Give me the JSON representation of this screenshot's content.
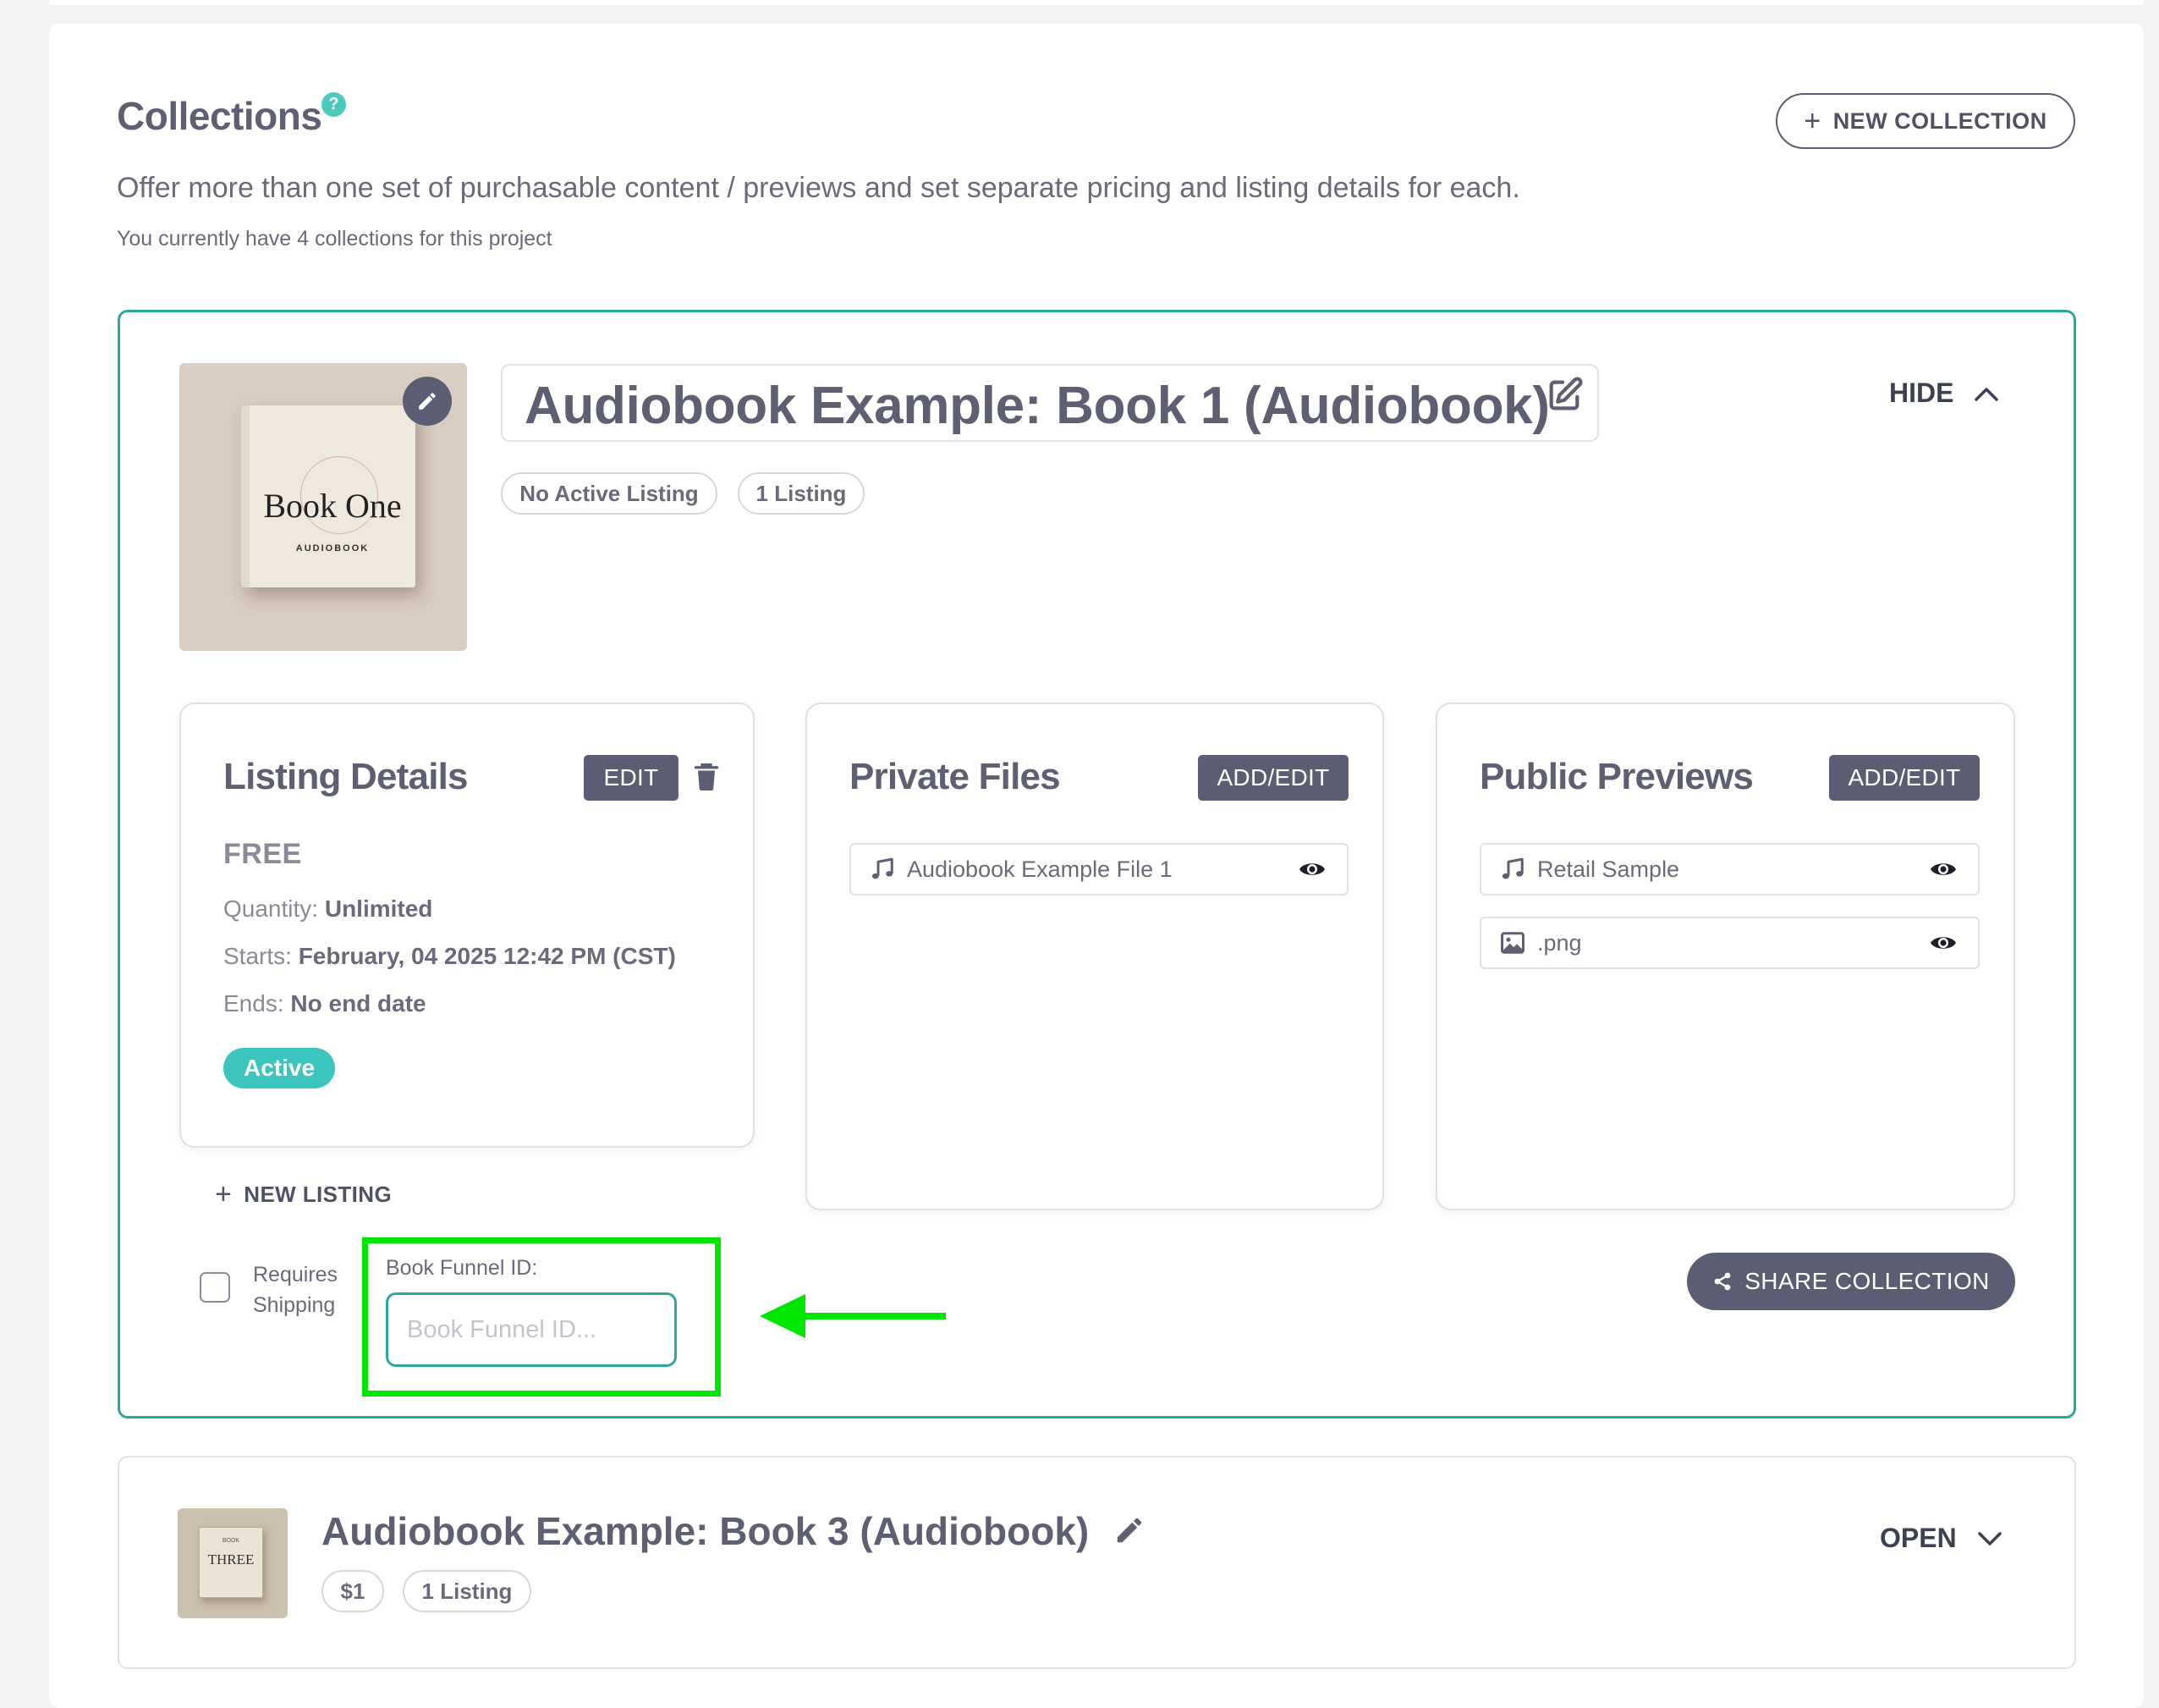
{
  "header": {
    "title": "Collections",
    "help_icon": "?",
    "new_collection_label": "NEW COLLECTION",
    "subtitle": "Offer more than one set of purchasable content / previews and set separate pricing and listing details for each.",
    "count_text": "You currently have 4 collections for this project"
  },
  "collection1": {
    "title": "Audiobook Example: Book 1 (Audiobook)",
    "cover_title": "Book One",
    "cover_subtitle": "AUDIOBOOK",
    "badges": [
      "No Active Listing",
      "1 Listing"
    ],
    "toggle_label": "HIDE",
    "listing": {
      "heading": "Listing Details",
      "edit_label": "EDIT",
      "price": "FREE",
      "quantity_label": "Quantity:",
      "quantity_value": "Unlimited",
      "starts_label": "Starts:",
      "starts_value": "February, 04 2025 12:42 PM (CST)",
      "ends_label": "Ends:",
      "ends_value": "No end date",
      "status": "Active"
    },
    "private_files": {
      "heading": "Private Files",
      "button_label": "ADD/EDIT",
      "files": [
        {
          "name": "Audiobook Example File 1",
          "icon": "music-icon"
        }
      ]
    },
    "public_previews": {
      "heading": "Public Previews",
      "button_label": "ADD/EDIT",
      "files": [
        {
          "name": "Retail Sample",
          "icon": "music-icon"
        },
        {
          "name": ".png",
          "icon": "image-icon"
        }
      ]
    },
    "new_listing_label": "NEW LISTING",
    "requires_shipping_line1": "Requires",
    "requires_shipping_line2": "Shipping",
    "book_funnel_label": "Book Funnel ID:",
    "book_funnel_placeholder": "Book Funnel ID...",
    "book_funnel_value": "",
    "share_label": "SHARE COLLECTION"
  },
  "collection2": {
    "title": "Audiobook Example: Book 3 (Audiobook)",
    "cover_title": "THREE",
    "cover_subtitle": "BOOK",
    "badges": [
      "$1",
      "1 Listing"
    ],
    "toggle_label": "OPEN"
  },
  "colors": {
    "accent_teal": "#2aa89a",
    "active_badge": "#3cc5be",
    "dark_button": "#5b5d72",
    "highlight_green": "#00e600"
  }
}
